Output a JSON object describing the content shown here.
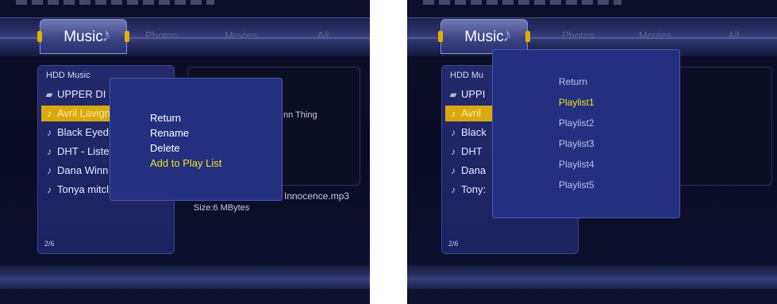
{
  "tabs": {
    "active": "Music",
    "others": [
      "Photos",
      "Movies",
      "All"
    ]
  },
  "left_screen": {
    "panel_title": "HDD Music",
    "files": [
      {
        "name": "UPPER DI",
        "type": "folder"
      },
      {
        "name": "Avril Lavign",
        "type": "music",
        "selected": true
      },
      {
        "name": "Black Eyed",
        "type": "music"
      },
      {
        "name": "DHT - Liste",
        "type": "music"
      },
      {
        "name": "Dana Winn",
        "type": "music"
      },
      {
        "name": "Tonya mitcl",
        "type": "music"
      }
    ],
    "page_counter": "2/6",
    "info": {
      "title_fragment": "nn Thing",
      "file_fragment": "Innocence.mp3",
      "size": "Size:6 MBytes"
    },
    "popup": {
      "items": [
        "Return",
        "Rename",
        "Delete",
        "Add to Play List"
      ],
      "highlighted_index": 3
    }
  },
  "right_screen": {
    "panel_title": "HDD Mu",
    "files": [
      {
        "name": "UPPI",
        "type": "folder"
      },
      {
        "name": "Avril",
        "type": "music",
        "selected": true
      },
      {
        "name": "Black",
        "type": "music"
      },
      {
        "name": "DHT",
        "type": "music"
      },
      {
        "name": "Dana",
        "type": "music"
      },
      {
        "name": "Tony:",
        "type": "music"
      }
    ],
    "page_counter": "2/6",
    "popup": {
      "items": [
        "Return",
        "Playlist1",
        "Playlist2",
        "Playlist3",
        "Playlist4",
        "Playlist5"
      ],
      "highlighted_index": 1
    }
  },
  "colors": {
    "background": "#0b0d27",
    "selection": "#d9a910",
    "highlight_text": "#f4e21a",
    "popup_background": "#22307f"
  },
  "icons": {
    "folder": "folder-icon",
    "music": "music-note-icon"
  }
}
